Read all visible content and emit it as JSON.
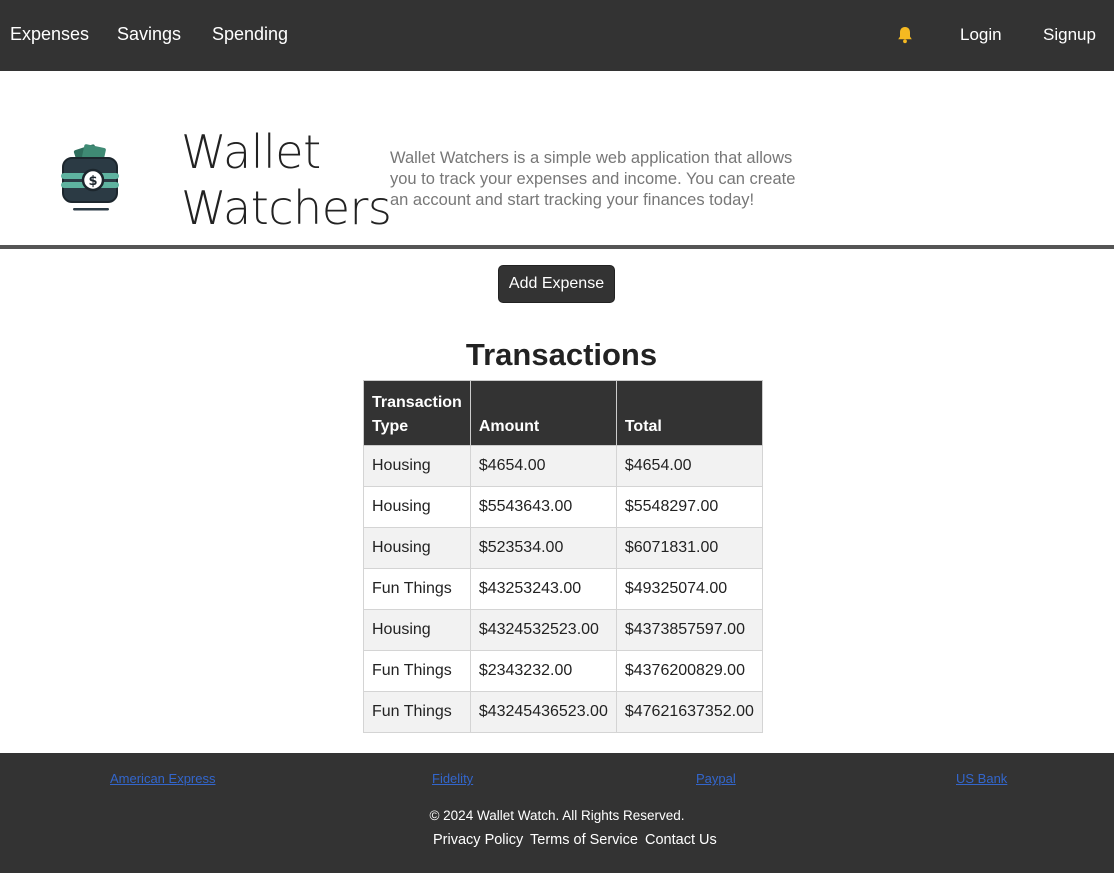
{
  "nav": {
    "left": [
      "Expenses",
      "Savings",
      "Spending"
    ],
    "login": "Login",
    "signup": "Signup",
    "bell_icon": "bell-icon",
    "bell_color": "#f5b921"
  },
  "hero": {
    "brand_line1": "Wallet",
    "brand_line2": "Watchers",
    "tagline": "Wallet Watchers is a simple web application that allows you to track your expenses and income. You can create an account and start tracking your finances today!",
    "logo_icon": "wallet-icon"
  },
  "actions": {
    "add_expense": "Add Expense"
  },
  "transactions": {
    "title": "Transactions",
    "headers": [
      "Transaction Type",
      "Amount",
      "Total"
    ],
    "rows": [
      [
        "Housing",
        "$4654.00",
        "$4654.00"
      ],
      [
        "Housing",
        "$5543643.00",
        "$5548297.00"
      ],
      [
        "Housing",
        "$523534.00",
        "$6071831.00"
      ],
      [
        "Fun Things",
        "$43253243.00",
        "$49325074.00"
      ],
      [
        "Housing",
        "$4324532523.00",
        "$4373857597.00"
      ],
      [
        "Fun Things",
        "$2343232.00",
        "$4376200829.00"
      ],
      [
        "Fun Things",
        "$43245436523.00",
        "$47621637352.00"
      ]
    ]
  },
  "footer": {
    "links": [
      "American Express",
      "Fidelity",
      "Paypal",
      "US Bank"
    ],
    "copyright": "© 2024 Wallet Watch. All Rights Reserved.",
    "privacy": "Privacy Policy",
    "terms": "Terms of Service",
    "contact": "Contact Us"
  },
  "colors": {
    "navbar": "#333333",
    "link": "#3366cc",
    "accent": "#f5b921"
  }
}
